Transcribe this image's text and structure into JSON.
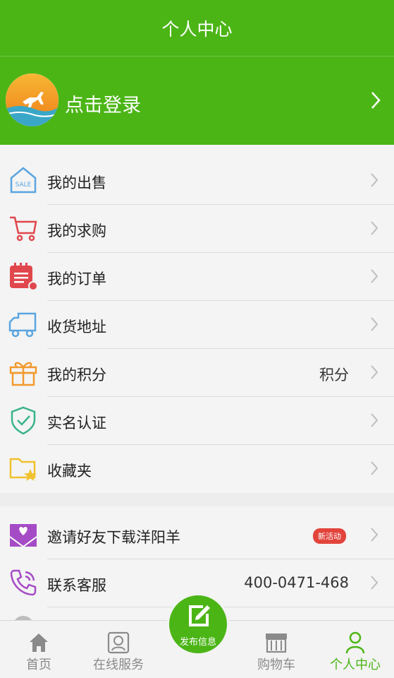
{
  "header": {
    "title": "个人中心"
  },
  "login": {
    "text": "点击登录"
  },
  "menu": [
    {
      "label": "我的出售",
      "icon": "sale-house-icon"
    },
    {
      "label": "我的求购",
      "icon": "shopping-cart-icon"
    },
    {
      "label": "我的订单",
      "icon": "order-calendar-icon"
    },
    {
      "label": "收货地址",
      "icon": "truck-icon"
    },
    {
      "label": "我的积分",
      "icon": "gift-icon",
      "value": "积分"
    },
    {
      "label": "实名认证",
      "icon": "shield-check-icon"
    },
    {
      "label": "收藏夹",
      "icon": "folder-star-icon"
    }
  ],
  "menu2": [
    {
      "label": "邀请好友下载洋阳羊",
      "icon": "invite-heart-icon",
      "badge": "新活动"
    },
    {
      "label": "联系客服",
      "icon": "phone-icon",
      "value": "400-0471-468"
    }
  ],
  "tabs": [
    {
      "label": "首页",
      "icon": "home-icon"
    },
    {
      "label": "在线服务",
      "icon": "service-icon"
    },
    {
      "label": "购物车",
      "icon": "store-icon"
    },
    {
      "label": "个人中心",
      "icon": "person-icon",
      "active": true
    }
  ],
  "fab": {
    "label": "发布信息"
  },
  "colors": {
    "brand": "#4bb516",
    "badge": "#e2443c",
    "text": "#222222"
  }
}
